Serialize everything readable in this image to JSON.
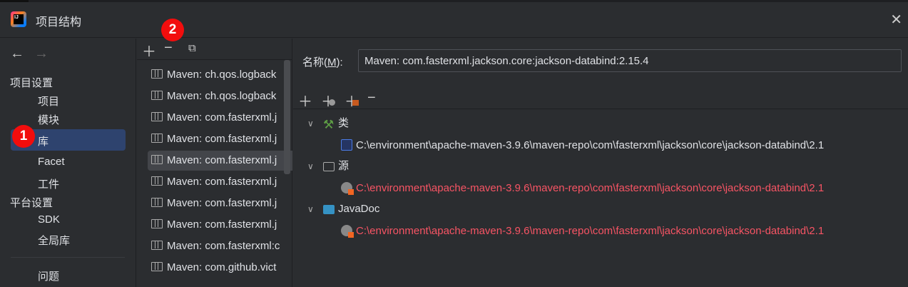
{
  "window": {
    "title": "项目结构"
  },
  "sidebar": {
    "sections": [
      {
        "label": "项目设置",
        "items": [
          "项目",
          "模块",
          "库",
          "Facet",
          "工件"
        ]
      },
      {
        "label": "平台设置",
        "items": [
          "SDK",
          "全局库"
        ]
      }
    ],
    "problems": "问题",
    "selected": "库"
  },
  "badges": {
    "one": "1",
    "two": "2"
  },
  "libraries": [
    "Maven: ch.qos.logback",
    "Maven: ch.qos.logback",
    "Maven: com.fasterxml.j",
    "Maven: com.fasterxml.j",
    "Maven: com.fasterxml.j",
    "Maven: com.fasterxml.j",
    "Maven: com.fasterxml.j",
    "Maven: com.fasterxml.j",
    "Maven: com.fasterxml:c",
    "Maven: com.github.vict"
  ],
  "detail": {
    "name_label": "名称(",
    "name_mnemonic": "M",
    "name_label_end": "):",
    "name_value": "Maven: com.fasterxml.jackson.core:jackson-databind:2.15.4",
    "tree": {
      "classes": "类",
      "classes_path": "C:\\environment\\apache-maven-3.9.6\\maven-repo\\com\\fasterxml\\jackson\\core\\jackson-databind\\2.1",
      "sources": "源",
      "sources_path": "C:\\environment\\apache-maven-3.9.6\\maven-repo\\com\\fasterxml\\jackson\\core\\jackson-databind\\2.1",
      "javadoc": "JavaDoc",
      "javadoc_path": "C:\\environment\\apache-maven-3.9.6\\maven-repo\\com\\fasterxml\\jackson\\core\\jackson-databind\\2.1"
    }
  },
  "colors": {
    "selection": "#2e436e",
    "missing_path": "#f75464",
    "badge": "#f20d0d"
  }
}
